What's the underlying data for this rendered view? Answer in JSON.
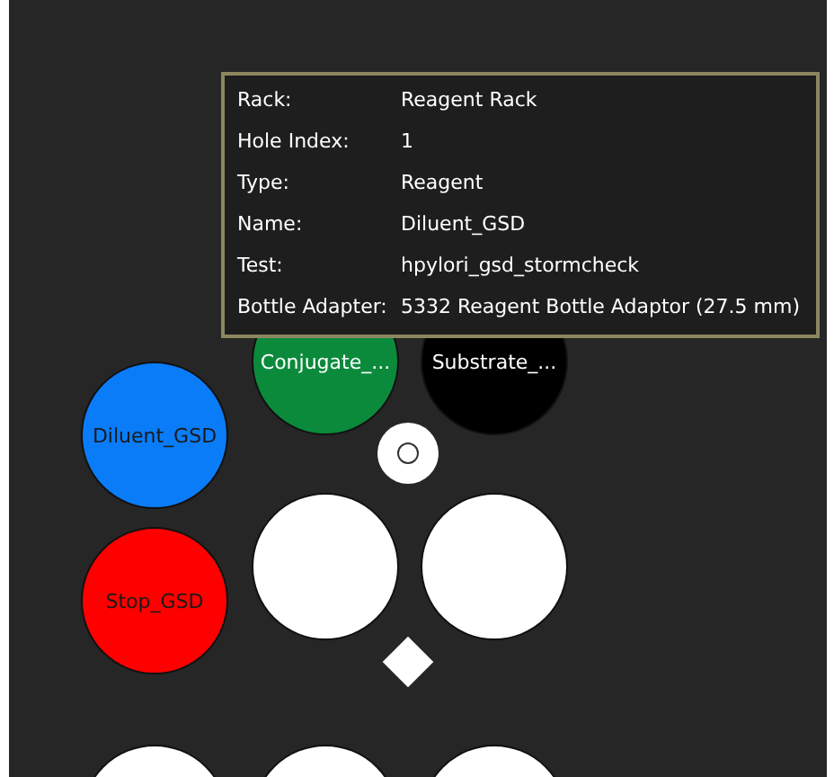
{
  "wells": [
    {
      "kind": "bottle",
      "label": "Conjugate_...",
      "color": "#0b8a3c"
    },
    {
      "kind": "bottle",
      "label": "Substrate_...",
      "color": "#000000"
    },
    {
      "kind": "bottle",
      "label": "Diluent_GSD",
      "color": "#0a7cf8"
    },
    {
      "kind": "small"
    },
    {
      "kind": "bottle",
      "label": "Stop_GSD",
      "color": "#ff0000"
    },
    {
      "kind": "bottle",
      "color": "#ffffff"
    },
    {
      "kind": "bottle",
      "color": "#ffffff"
    },
    {
      "kind": "diamond"
    },
    {
      "kind": "bottle",
      "color": "#ffffff"
    },
    {
      "kind": "bottle",
      "color": "#ffffff"
    },
    {
      "kind": "bottle",
      "color": "#ffffff"
    }
  ],
  "tooltip": {
    "rows": [
      {
        "label": "Rack:",
        "value": "Reagent Rack"
      },
      {
        "label": "Hole Index:",
        "value": "1"
      },
      {
        "label": "Type:",
        "value": "Reagent"
      },
      {
        "label": "Name:",
        "value": "Diluent_GSD"
      },
      {
        "label": "Test:",
        "value": "hpylori_gsd_stormcheck"
      },
      {
        "label": "Bottle Adapter:",
        "value": "5332 Reagent Bottle Adaptor (27.5 mm)"
      }
    ]
  }
}
